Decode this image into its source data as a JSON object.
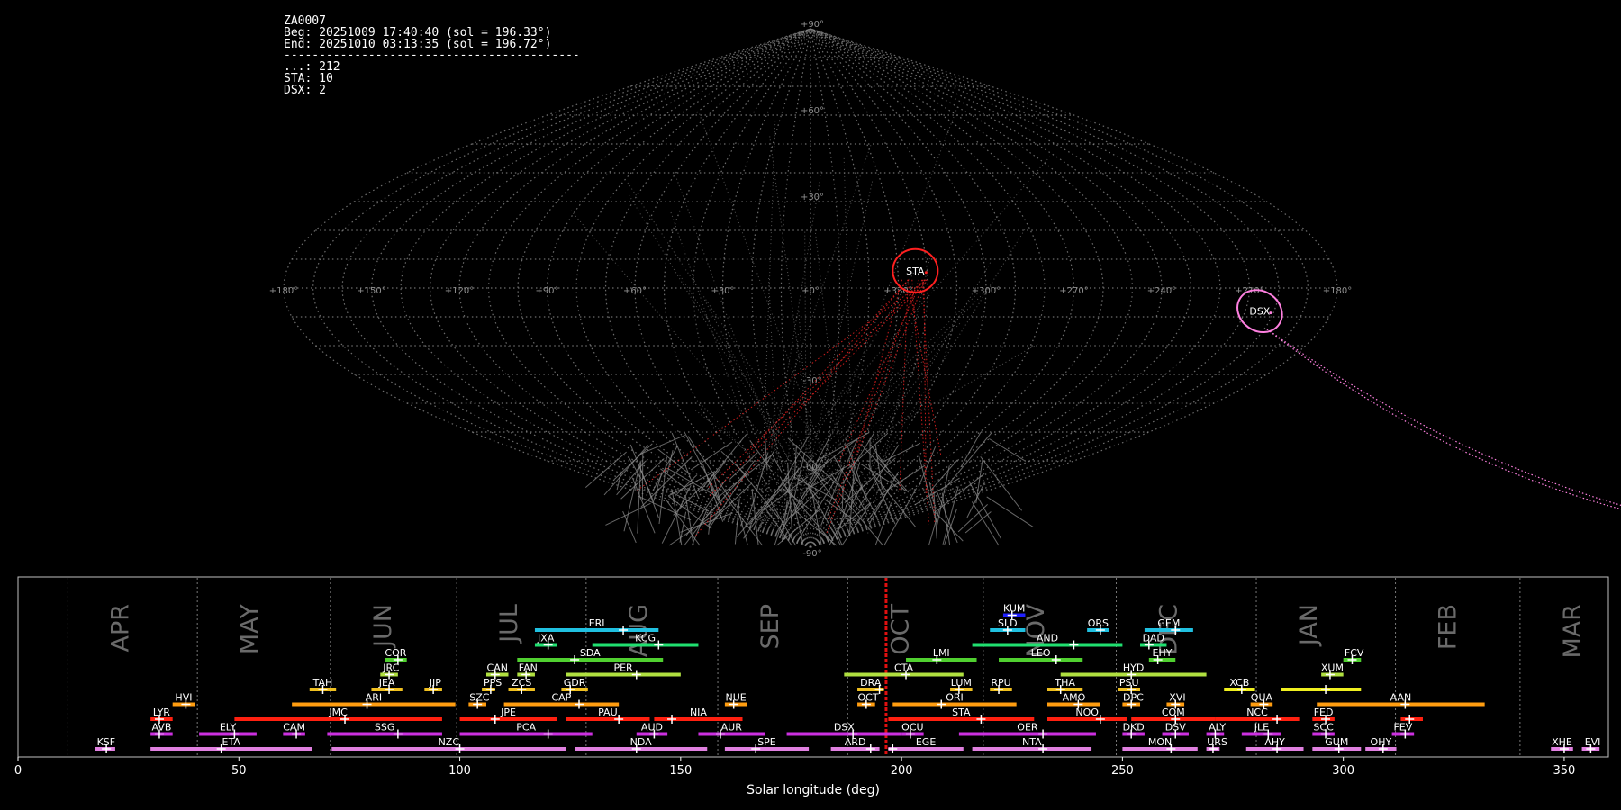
{
  "info_panel": {
    "station_id": "ZA0007",
    "begin": "Beg: 20251009 17:40:40 (sol = 196.33°)",
    "end": "End: 20251010 03:13:35 (sol = 196.72°)",
    "separator": "------------------------------------------",
    "counts": [
      "...: 212",
      "STA: 10",
      "DSX: 2"
    ]
  },
  "chart_data": [
    {
      "type": "scatter",
      "projection": "sinusoidal (radiant map)",
      "grid": true,
      "lon_tick_labels": [
        "+180°",
        "+150°",
        "+120°",
        "+90°",
        "+60°",
        "+30°",
        "+0°",
        "+330°",
        "+300°",
        "+270°",
        "+240°",
        "+210°",
        "+180°"
      ],
      "lat_tick_labels": [
        "+90°",
        "+60°",
        "+30°",
        "+0°",
        "-30°",
        "-60°",
        "-90°"
      ],
      "shower_circles": [
        {
          "label": "STA",
          "color": "#ff2020",
          "lon": 36,
          "lat": 6
        },
        {
          "label": "DSX",
          "color": "#ff80e0",
          "lon": 155,
          "lat": -8
        }
      ],
      "meteor_counts": {
        "sporadic": 212,
        "STA": 10,
        "DSX": 2
      }
    },
    {
      "type": "bar",
      "xlabel": "Solar longitude (deg)",
      "xlim": [
        0,
        360
      ],
      "x_ticks": [
        0,
        50,
        100,
        150,
        200,
        250,
        300,
        350
      ],
      "current_sol": 196.5,
      "months": [
        {
          "label": "APR",
          "start": 11.3
        },
        {
          "label": "MAY",
          "start": 40.6
        },
        {
          "label": "JUN",
          "start": 70.7
        },
        {
          "label": "JUL",
          "start": 99.3
        },
        {
          "label": "AUG",
          "start": 128.6
        },
        {
          "label": "SEP",
          "start": 158.4
        },
        {
          "label": "OCT",
          "start": 187.8
        },
        {
          "label": "NOV",
          "start": 218.5
        },
        {
          "label": "DEC",
          "start": 248.6
        },
        {
          "label": "JAN",
          "start": 280.3
        },
        {
          "label": "FEB",
          "start": 311.8
        },
        {
          "label": "MAR",
          "start": 340.0
        }
      ],
      "showers": [
        {
          "code": "KSF",
          "start": 17.5,
          "end": 22,
          "peak": 20,
          "row": 0,
          "color": "#e080e0"
        },
        {
          "code": "ETA",
          "start": 30,
          "end": 66.5,
          "peak": 46,
          "row": 0,
          "color": "#e080e0"
        },
        {
          "code": "NZC",
          "start": 71,
          "end": 124,
          "peak": 100,
          "row": 0,
          "color": "#e080e0"
        },
        {
          "code": "NDA",
          "start": 126,
          "end": 156,
          "peak": 140,
          "row": 0,
          "color": "#e080e0"
        },
        {
          "code": "SPE",
          "start": 160,
          "end": 179,
          "peak": 167,
          "row": 0,
          "color": "#e080e0"
        },
        {
          "code": "ARD",
          "start": 184,
          "end": 195,
          "peak": 193,
          "row": 0,
          "color": "#e080e0"
        },
        {
          "code": "EGE",
          "start": 197,
          "end": 214,
          "peak": 198,
          "row": 0,
          "color": "#e080e0"
        },
        {
          "code": "NTA",
          "start": 216,
          "end": 243,
          "peak": 232,
          "row": 0,
          "color": "#e080e0"
        },
        {
          "code": "MON",
          "start": 250,
          "end": 267,
          "peak": 261,
          "row": 0,
          "color": "#e080e0"
        },
        {
          "code": "URS",
          "start": 269,
          "end": 272,
          "peak": 270.5,
          "row": 0,
          "color": "#e080e0"
        },
        {
          "code": "AHY",
          "start": 278,
          "end": 291,
          "peak": 285,
          "row": 0,
          "color": "#e080e0"
        },
        {
          "code": "GUM",
          "start": 293,
          "end": 304,
          "peak": 299,
          "row": 0,
          "color": "#e080e0"
        },
        {
          "code": "OHY",
          "start": 305,
          "end": 312,
          "peak": 309,
          "row": 0,
          "color": "#e080e0"
        },
        {
          "code": "XHE",
          "start": 347,
          "end": 352,
          "peak": 350,
          "row": 0,
          "color": "#e080e0"
        },
        {
          "code": "EVI",
          "start": 354,
          "end": 358,
          "peak": 356,
          "row": 0,
          "color": "#e080e0"
        },
        {
          "code": "AVB",
          "start": 30,
          "end": 35,
          "peak": 32,
          "row": 1,
          "color": "#cc30e0"
        },
        {
          "code": "ELY",
          "start": 41,
          "end": 54,
          "peak": 49,
          "row": 1,
          "color": "#cc30e0"
        },
        {
          "code": "CAM",
          "start": 60,
          "end": 65,
          "peak": 63,
          "row": 1,
          "color": "#cc30e0"
        },
        {
          "code": "SSG",
          "start": 70,
          "end": 96,
          "peak": 86,
          "row": 1,
          "color": "#cc30e0"
        },
        {
          "code": "PCA",
          "start": 100,
          "end": 130,
          "peak": 120,
          "row": 1,
          "color": "#cc30e0"
        },
        {
          "code": "AUD",
          "start": 140,
          "end": 147,
          "peak": 144,
          "row": 1,
          "color": "#cc30e0"
        },
        {
          "code": "AUR",
          "start": 154,
          "end": 169,
          "peak": 159,
          "row": 1,
          "color": "#cc30e0"
        },
        {
          "code": "DSX",
          "start": 174,
          "end": 200,
          "peak": 189,
          "row": 1,
          "color": "#cc30e0"
        },
        {
          "code": "OCU",
          "start": 200,
          "end": 205,
          "peak": 202,
          "row": 1,
          "color": "#cc30e0"
        },
        {
          "code": "OER",
          "start": 213,
          "end": 244,
          "peak": 232,
          "row": 1,
          "color": "#cc30e0"
        },
        {
          "code": "DKD",
          "start": 250,
          "end": 255,
          "peak": 252,
          "row": 1,
          "color": "#cc30e0"
        },
        {
          "code": "DSV",
          "start": 259,
          "end": 265,
          "peak": 262,
          "row": 1,
          "color": "#cc30e0"
        },
        {
          "code": "ALY",
          "start": 269,
          "end": 273,
          "peak": 271,
          "row": 1,
          "color": "#cc30e0"
        },
        {
          "code": "JLE",
          "start": 277,
          "end": 286,
          "peak": 283,
          "row": 1,
          "color": "#cc30e0"
        },
        {
          "code": "SCC",
          "start": 293,
          "end": 298,
          "peak": 296,
          "row": 1,
          "color": "#cc30e0"
        },
        {
          "code": "FEV",
          "start": 311,
          "end": 316,
          "peak": 314,
          "row": 1,
          "color": "#cc30e0"
        },
        {
          "code": "LYR",
          "start": 30,
          "end": 35,
          "peak": 32,
          "row": 2,
          "color": "#ff2010"
        },
        {
          "code": "JMC",
          "start": 49,
          "end": 96,
          "peak": 74,
          "row": 2,
          "color": "#ff2010"
        },
        {
          "code": "JPE",
          "start": 100,
          "end": 122,
          "peak": 108,
          "row": 2,
          "color": "#ff2010"
        },
        {
          "code": "PAU",
          "start": 124,
          "end": 143,
          "peak": 136,
          "row": 2,
          "color": "#ff2010"
        },
        {
          "code": "NIA",
          "start": 144,
          "end": 164,
          "peak": 148,
          "row": 2,
          "color": "#ff2010"
        },
        {
          "code": "STA",
          "start": 197,
          "end": 230,
          "peak": 218,
          "row": 2,
          "color": "#ff2010"
        },
        {
          "code": "NOO",
          "start": 233,
          "end": 251,
          "peak": 245,
          "row": 2,
          "color": "#ff2010"
        },
        {
          "code": "COM",
          "start": 252,
          "end": 271,
          "peak": 262,
          "row": 2,
          "color": "#ff2010"
        },
        {
          "code": "NCC",
          "start": 271,
          "end": 290,
          "peak": 285,
          "row": 2,
          "color": "#ff2010"
        },
        {
          "code": "FED",
          "start": 293,
          "end": 298,
          "peak": 296,
          "row": 2,
          "color": "#ff2010"
        },
        {
          "code": "",
          "start": 313,
          "end": 318,
          "peak": 315,
          "row": 2,
          "color": "#ff2010"
        },
        {
          "code": "HVI",
          "start": 35,
          "end": 40,
          "peak": 38,
          "row": 3,
          "color": "#ff9d10"
        },
        {
          "code": "ARI",
          "start": 62,
          "end": 99,
          "peak": 79,
          "row": 3,
          "color": "#ff9d10"
        },
        {
          "code": "SZC",
          "start": 102,
          "end": 106,
          "peak": 104,
          "row": 3,
          "color": "#ff9d10"
        },
        {
          "code": "CAP",
          "start": 110,
          "end": 136,
          "peak": 127,
          "row": 3,
          "color": "#ff9d10"
        },
        {
          "code": "NUE",
          "start": 160,
          "end": 165,
          "peak": 162,
          "row": 3,
          "color": "#ff9d10"
        },
        {
          "code": "OCT",
          "start": 190,
          "end": 194,
          "peak": 192,
          "row": 3,
          "color": "#ff9d10"
        },
        {
          "code": "ORI",
          "start": 198,
          "end": 226,
          "peak": 209,
          "row": 3,
          "color": "#ff9d10"
        },
        {
          "code": "AMO",
          "start": 233,
          "end": 245,
          "peak": 240,
          "row": 3,
          "color": "#ff9d10"
        },
        {
          "code": "DPC",
          "start": 250,
          "end": 254,
          "peak": 252,
          "row": 3,
          "color": "#ff9d10"
        },
        {
          "code": "XVI",
          "start": 260,
          "end": 264,
          "peak": 262,
          "row": 3,
          "color": "#ff9d10"
        },
        {
          "code": "QUA",
          "start": 279,
          "end": 284,
          "peak": 282,
          "row": 3,
          "color": "#ff9d10"
        },
        {
          "code": "AAN",
          "start": 294,
          "end": 332,
          "peak": 314,
          "row": 3,
          "color": "#ff9d10"
        },
        {
          "code": "TAH",
          "start": 66,
          "end": 72,
          "peak": 69,
          "row": 4,
          "color": "#f0c020"
        },
        {
          "code": "JEA",
          "start": 80,
          "end": 87,
          "peak": 84,
          "row": 4,
          "color": "#f0c020"
        },
        {
          "code": "JIP",
          "start": 92,
          "end": 96,
          "peak": 94,
          "row": 4,
          "color": "#f0c020"
        },
        {
          "code": "PPS",
          "start": 105,
          "end": 108,
          "peak": 107,
          "row": 4,
          "color": "#f0c020"
        },
        {
          "code": "ZCS",
          "start": 111,
          "end": 117,
          "peak": 114,
          "row": 4,
          "color": "#f0c020"
        },
        {
          "code": "GDR",
          "start": 123,
          "end": 129,
          "peak": 125,
          "row": 4,
          "color": "#f0c020"
        },
        {
          "code": "DRA",
          "start": 190,
          "end": 196,
          "peak": 195,
          "row": 4,
          "color": "#f0c020"
        },
        {
          "code": "LUM",
          "start": 211,
          "end": 216,
          "peak": 213,
          "row": 4,
          "color": "#f0c020"
        },
        {
          "code": "RPU",
          "start": 220,
          "end": 225,
          "peak": 222,
          "row": 4,
          "color": "#f0c020"
        },
        {
          "code": "THA",
          "start": 233,
          "end": 241,
          "peak": 236,
          "row": 4,
          "color": "#f0c020"
        },
        {
          "code": "PSU",
          "start": 249,
          "end": 254,
          "peak": 252,
          "row": 4,
          "color": "#f0c020"
        },
        {
          "code": "XCB",
          "start": 273,
          "end": 280,
          "peak": 277,
          "row": 4,
          "color": "#f0f020"
        },
        {
          "code": "",
          "start": 286,
          "end": 304,
          "peak": 296,
          "row": 4,
          "color": "#f0f020"
        },
        {
          "code": "JRC",
          "start": 82,
          "end": 86,
          "peak": 84,
          "row": 5,
          "color": "#b0e040"
        },
        {
          "code": "CAN",
          "start": 106,
          "end": 111,
          "peak": 108,
          "row": 5,
          "color": "#b0e040"
        },
        {
          "code": "FAN",
          "start": 113,
          "end": 117,
          "peak": 115,
          "row": 5,
          "color": "#b0e040"
        },
        {
          "code": "PER",
          "start": 124,
          "end": 150,
          "peak": 140,
          "row": 5,
          "color": "#b0e040"
        },
        {
          "code": "CTA",
          "start": 187,
          "end": 214,
          "peak": 201,
          "row": 5,
          "color": "#b0e040"
        },
        {
          "code": "HYD",
          "start": 236,
          "end": 269,
          "peak": 252,
          "row": 5,
          "color": "#b0e040"
        },
        {
          "code": "XUM",
          "start": 295,
          "end": 300,
          "peak": 297,
          "row": 5,
          "color": "#b0e040"
        },
        {
          "code": "COR",
          "start": 83,
          "end": 88,
          "peak": 86,
          "row": 6,
          "color": "#50d030"
        },
        {
          "code": "SDA",
          "start": 113,
          "end": 146,
          "peak": 126,
          "row": 6,
          "color": "#50d030"
        },
        {
          "code": "LMI",
          "start": 201,
          "end": 217,
          "peak": 208,
          "row": 6,
          "color": "#50d030"
        },
        {
          "code": "LEO",
          "start": 222,
          "end": 241,
          "peak": 235,
          "row": 6,
          "color": "#50d030"
        },
        {
          "code": "EHY",
          "start": 256,
          "end": 262,
          "peak": 258,
          "row": 6,
          "color": "#50d030"
        },
        {
          "code": "FCV",
          "start": 300,
          "end": 304,
          "peak": 302,
          "row": 6,
          "color": "#50d030"
        },
        {
          "code": "JXA",
          "start": 117,
          "end": 122,
          "peak": 120,
          "row": 7,
          "color": "#20e070"
        },
        {
          "code": "KCG",
          "start": 130,
          "end": 154,
          "peak": 145,
          "row": 7,
          "color": "#20e070"
        },
        {
          "code": "AND",
          "start": 216,
          "end": 250,
          "peak": 239,
          "row": 7,
          "color": "#20e070"
        },
        {
          "code": "DAD",
          "start": 254,
          "end": 260,
          "peak": 256,
          "row": 7,
          "color": "#20e070"
        },
        {
          "code": "ERI",
          "start": 117,
          "end": 145,
          "peak": 137,
          "row": 8,
          "color": "#20c0e0"
        },
        {
          "code": "SLD",
          "start": 220,
          "end": 228,
          "peak": 224,
          "row": 8,
          "color": "#20c0e0"
        },
        {
          "code": "ORS",
          "start": 242,
          "end": 247,
          "peak": 245,
          "row": 8,
          "color": "#20c0e0"
        },
        {
          "code": "GEM",
          "start": 255,
          "end": 266,
          "peak": 262,
          "row": 8,
          "color": "#20c0e0"
        },
        {
          "code": "KUM",
          "start": 223,
          "end": 228,
          "peak": 225,
          "row": 9,
          "color": "#2020ff"
        }
      ]
    }
  ]
}
